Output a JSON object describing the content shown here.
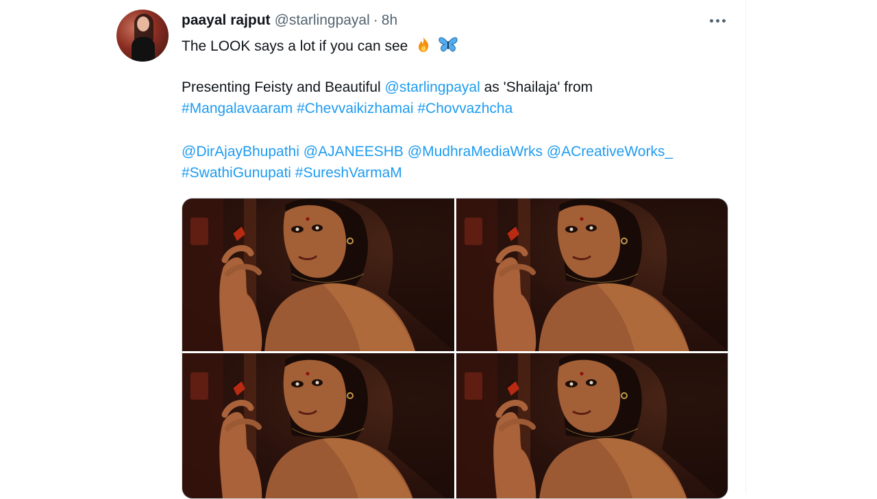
{
  "tweet": {
    "author": {
      "display_name": "paayal rajput",
      "handle": "@starlingpayal",
      "separator": "·",
      "time": "8h"
    },
    "line1": "The LOOK says a lot if you can see",
    "line1_emojis": [
      "fire-emoji",
      "butterfly-emoji"
    ],
    "line2_prefix": "Presenting Feisty and Beautiful",
    "line2_mention": "@starlingpayal",
    "line2_suffix": "as 'Shailaja' from",
    "hashtags_line1": [
      "#Mangalavaaram",
      "#Chevvaikizhamai",
      "#Chovvazhcha"
    ],
    "mentions_line": [
      "@DirAjayBhupathi",
      "@AJANEESHB",
      "@MudhraMediaWrks",
      "@ACreativeWorks_"
    ],
    "hashtags_line2": [
      "#SwathiGunupati",
      "#SureshVarmaM"
    ],
    "media_count": 4
  },
  "colors": {
    "link": "#1d9bf0",
    "text": "#0f1419",
    "secondary": "#536471"
  }
}
